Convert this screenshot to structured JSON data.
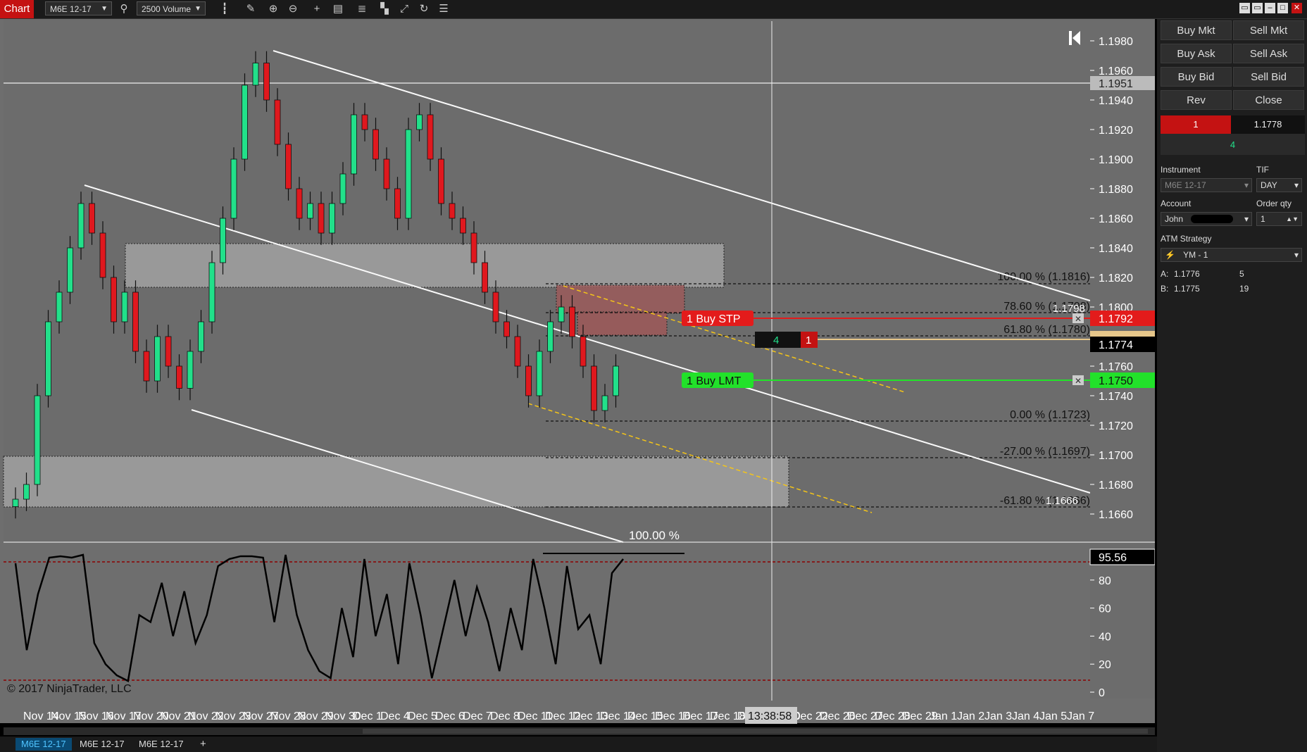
{
  "toolbar": {
    "chart_label": "Chart",
    "instrument": "M6E 12-17",
    "bar_type": "2500 Volume"
  },
  "chart": {
    "price_axis": [
      "1.1980",
      "1.1960",
      "1.1951",
      "1.1940",
      "1.1920",
      "1.1900",
      "1.1880",
      "1.1860",
      "1.1840",
      "1.1820",
      "1.1800",
      "1.1760",
      "1.1740",
      "1.1720",
      "1.1700",
      "1.1680",
      "1.1660"
    ],
    "current_price": "1.1774",
    "stop_price": "1.1792",
    "limit_price": "1.1750",
    "horizontal_line_price": "1.1951",
    "osc_axis": [
      "80",
      "60",
      "40",
      "20",
      "0"
    ],
    "osc_value": "95.56",
    "fib_labels": [
      "100.00 % (1.1816)",
      "78.60 % (1.1798)",
      "61.80 % (1.1780)",
      "0.00 % (1.1723)",
      "-27.00 % (1.1697)",
      "-61.80 % (1.1666)"
    ],
    "fib_partial": [
      "1.1798",
      "1.1666"
    ],
    "channel_pct": "100.00 %",
    "stop_order_label": "1 Buy STP",
    "limit_order_label": "1 Buy LMT",
    "position_qty": "4",
    "position_pending": "1",
    "copyright": "© 2017 NinjaTrader, LLC",
    "crosshair_time": "13:38:58",
    "date_labels": [
      "Nov 14",
      "Nov 15",
      "Nov 16",
      "Nov 17",
      "Nov 20",
      "Nov 21",
      "Nov 22",
      "Nov 23",
      "Nov 27",
      "Nov 28",
      "Nov 29",
      "Nov 30",
      "Dec 1",
      "Dec 4",
      "Dec 5",
      "Dec 6",
      "Dec 7",
      "Dec 8",
      "Dec 11",
      "Dec 12",
      "Dec 13",
      "Dec 14",
      "Dec 15",
      "Dec 16",
      "Dec 17",
      "Dec 18",
      "Dec 19",
      "Dec 20",
      "Dec 22",
      "Dec 26",
      "Dec 27",
      "Dec 28",
      "Dec 29",
      "Jan 1",
      "Jan 2",
      "Jan 3",
      "Jan 4",
      "Jan 5",
      "Jan 7"
    ]
  },
  "panel": {
    "buy_mkt": "Buy Mkt",
    "sell_mkt": "Sell Mkt",
    "buy_ask": "Buy Ask",
    "sell_ask": "Sell Ask",
    "buy_bid": "Buy Bid",
    "sell_bid": "Sell Bid",
    "rev": "Rev",
    "close": "Close",
    "pos_qty": "1",
    "pos_price": "1.1778",
    "pos_pnl": "4",
    "instrument_label": "Instrument",
    "instrument_value": "M6E 12-17",
    "tif_label": "TIF",
    "tif_value": "DAY",
    "account_label": "Account",
    "account_value": "John",
    "order_qty_label": "Order qty",
    "order_qty_value": "1",
    "atm_label": "ATM Strategy",
    "atm_value": "YM - 1",
    "ask_label": "A:",
    "ask_price": "1.1776",
    "ask_size": "5",
    "bid_label": "B:",
    "bid_price": "1.1775",
    "bid_size": "19"
  },
  "tabs": [
    "M6E 12-17",
    "M6E 12-17",
    "M6E 12-17"
  ],
  "colors": {
    "up": "#22e08a",
    "down": "#e0181e",
    "stop": "#e31b1b",
    "limit": "#22e12a",
    "bg": "#6e6e6e"
  }
}
